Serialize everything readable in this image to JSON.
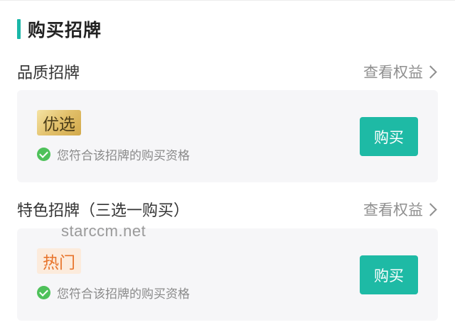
{
  "page": {
    "title": "购买招牌",
    "accent_color": "#1ab7a8"
  },
  "sections": [
    {
      "title": "品质招牌",
      "link_label": "查看权益",
      "card": {
        "badge_label": "优选",
        "qualify_text": "您符合该招牌的购买资格",
        "buy_label": "购买"
      }
    },
    {
      "title": "特色招牌（三选一购买）",
      "link_label": "查看权益",
      "card": {
        "badge_label": "热门",
        "qualify_text": "您符合该招牌的购买资格",
        "buy_label": "购买"
      }
    }
  ],
  "watermark": "starccm.net",
  "colors": {
    "buy_button": "#1ebaa5",
    "check": "#4ec15a",
    "hot_badge_text": "#e8742b"
  }
}
